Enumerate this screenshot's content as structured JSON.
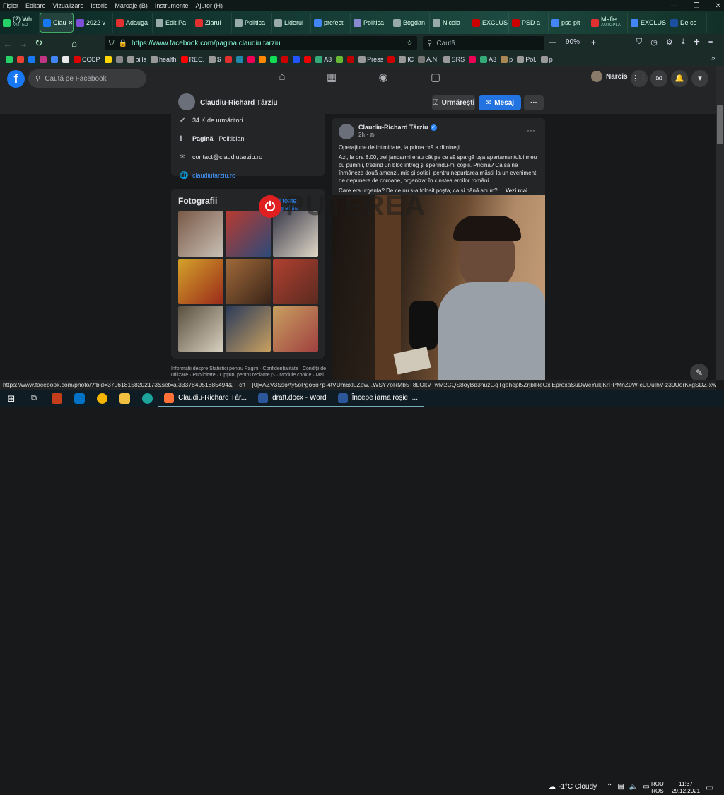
{
  "menu": [
    "Fișier",
    "Editare",
    "Vizualizare",
    "Istoric",
    "Marcaje (B)",
    "Instrumente",
    "Ajutor (H)"
  ],
  "tabs": [
    {
      "label": "(2) Wh",
      "sub": "MUTED",
      "color": "#25d366"
    },
    {
      "label": "Clau",
      "color": "#1877f2",
      "active": true
    },
    {
      "label": "2022 v",
      "color": "#7b4fd6"
    },
    {
      "label": "Adauga",
      "color": "#e03030"
    },
    {
      "label": "Edit Pa",
      "color": "#9aa"
    },
    {
      "label": "Ziarul",
      "color": "#e03030"
    },
    {
      "label": "Politica",
      "color": "#9aa"
    },
    {
      "label": "Liderul",
      "color": "#9aa"
    },
    {
      "label": "prefect",
      "color": "#4285f4"
    },
    {
      "label": "Politica",
      "color": "#8a8ad0"
    },
    {
      "label": "Bogdan",
      "color": "#9aa"
    },
    {
      "label": "Nicola",
      "color": "#9aa"
    },
    {
      "label": "EXCLUS",
      "color": "#c00"
    },
    {
      "label": "PSD a",
      "color": "#c00"
    },
    {
      "label": "psd pit",
      "color": "#4285f4"
    },
    {
      "label": "Mafie",
      "sub": "AUTOPLA",
      "color": "#e03030"
    },
    {
      "label": "EXCLUS",
      "color": "#4285f4"
    },
    {
      "label": "De ce",
      "color": "#1c4fa0"
    }
  ],
  "url": "https://www.facebook.com/pagina.claudiu.tarziu",
  "search_placeholder": "Caută",
  "zoom": "90%",
  "bookmarks": [
    {
      "label": "",
      "color": "#25d366"
    },
    {
      "label": "",
      "color": "#ea4335"
    },
    {
      "label": "",
      "color": "#1877f2"
    },
    {
      "label": "",
      "color": "#c13584"
    },
    {
      "label": "",
      "color": "#4285f4"
    },
    {
      "label": "",
      "color": "#e8e8e8"
    },
    {
      "label": "CCCP",
      "color": "#d00"
    },
    {
      "label": "",
      "color": "#ffd700"
    },
    {
      "label": "",
      "color": "#888"
    },
    {
      "label": "bills",
      "color": "#999"
    },
    {
      "label": "health",
      "color": "#999"
    },
    {
      "label": "REC.",
      "color": "#f00"
    },
    {
      "label": "$",
      "color": "#999"
    },
    {
      "label": "",
      "color": "#e03030"
    },
    {
      "label": "",
      "color": "#28a"
    },
    {
      "label": "",
      "color": "#e05"
    },
    {
      "label": "",
      "color": "#f80"
    },
    {
      "label": "",
      "color": "#1d5"
    },
    {
      "label": "",
      "color": "#c00"
    },
    {
      "label": "",
      "color": "#25f"
    },
    {
      "label": "",
      "color": "#e00"
    },
    {
      "label": "A3",
      "color": "#3a7"
    },
    {
      "label": "",
      "color": "#6b3"
    },
    {
      "label": "",
      "color": "#b00"
    },
    {
      "label": "Press",
      "color": "#999"
    },
    {
      "label": "",
      "color": "#c00"
    },
    {
      "label": "IC",
      "color": "#999"
    },
    {
      "label": "A.N.",
      "color": "#777"
    },
    {
      "label": "SRS",
      "color": "#999"
    },
    {
      "label": "",
      "color": "#e05"
    },
    {
      "label": "A3",
      "color": "#3a7"
    },
    {
      "label": "p",
      "color": "#a85"
    },
    {
      "label": "Pol.",
      "color": "#999"
    },
    {
      "label": "p",
      "color": "#999"
    }
  ],
  "fb": {
    "search_placeholder": "Caută pe Facebook",
    "user_name": "Narcis",
    "page_name": "Claudiu-Richard Târziu",
    "follow_label": "Urmărești",
    "message_label": "Mesaj",
    "more_label": "···"
  },
  "about": [
    {
      "icon": "✔",
      "text": "34 K de urmăritori"
    },
    {
      "icon": "ℹ",
      "text_bold": "Pagină",
      "text": " · Politician"
    },
    {
      "icon": "✉",
      "text": "contact@claudiutarziu.ro"
    },
    {
      "icon": "🌐",
      "text": "claudiutarziu.ro",
      "link": true
    }
  ],
  "photos": {
    "title": "Fotografii",
    "see_all": "Vezi toate fotografiile",
    "items": [
      {
        "colors": [
          "#7a5a48",
          "#c9c0b5"
        ]
      },
      {
        "colors": [
          "#b83a2f",
          "#2c4a7a"
        ]
      },
      {
        "colors": [
          "#3a3a4a",
          "#e0d8c8"
        ]
      },
      {
        "colors": [
          "#d4a22a",
          "#9a2a1a"
        ]
      },
      {
        "colors": [
          "#a06a3a",
          "#3a2418"
        ]
      },
      {
        "colors": [
          "#b04030",
          "#5a2a20"
        ]
      },
      {
        "colors": [
          "#5a5040",
          "#d8d0c0"
        ]
      },
      {
        "colors": [
          "#2a3a5a",
          "#c8a060"
        ]
      },
      {
        "colors": [
          "#c8a060",
          "#a04040"
        ]
      }
    ]
  },
  "footer_text": "Informații despre Statistici pentru Pagini · Confidențialitate · Condiții de utilizare · Publicitate · Opțiuni pentru reclame ▷ · Module cookie · Mai mult",
  "post": {
    "author": "Claudiu-Richard Târziu",
    "time": "2h ·",
    "more": "···",
    "lead": "Operațiune de intimidare, la prima oră a dimineții.",
    "body": "Azi, la ora 8.00, trei jandarmi erau cât pe ce să spargă ușa apartamentului meu cu pumnii, trezind un bloc întreg și sperindu-mi copiii. Pricina? Ca să ne înmâneze două amenzi, mie și soției, pentru nepurtarea măștii la un eveniment de depunere de coroane, organizat în cinstea eroilor români.",
    "question": "Care era urgența? De ce nu s-a folosit poșta, ca și până acum? ...",
    "see_more": "Vezi mai mult"
  },
  "watermark": "PUTEREA",
  "status_url": "https://www.facebook.com/photo/?fbid=370618158202173&set=a.333784951885494&__cft__[0]=AZV3SsoAy5oPgo6o7p-4tVUm6xluZpw...WSY7oRMb5T8LOkV_wM2CQS8oyBd3nuzGqTgehepl5ZrjblReOxiEproxaSuDWcYukjKrPPMnZ0W-cUDuIhV-z39UorKxgSDZ-xwssNRQ&__tn__=EH-R",
  "taskbar": {
    "apps": [
      {
        "label": "Claudiu-Richard Târ...",
        "color": "#ff7139"
      },
      {
        "label": "draft.docx - Word",
        "color": "#2b579a"
      },
      {
        "label": "Începe iarna roșie! ...",
        "color": "#2b579a"
      }
    ],
    "weather": "-1°C  Cloudy",
    "lang_top": "ROU",
    "lang_bottom": "ROS",
    "time": "11:37",
    "date": "29.12.2021"
  }
}
